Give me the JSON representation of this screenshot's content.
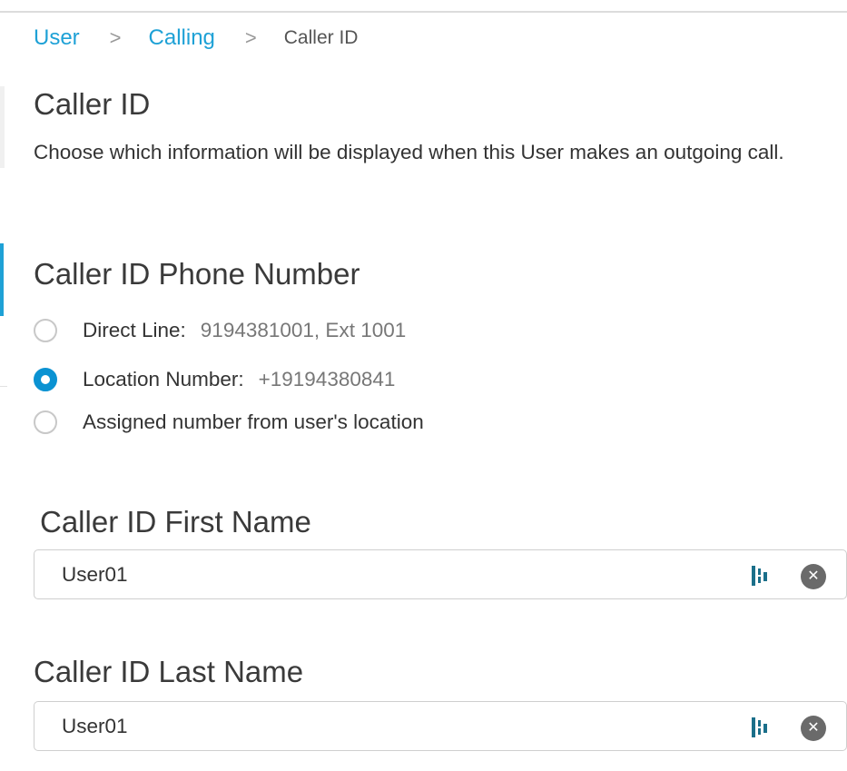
{
  "breadcrumb": {
    "items": [
      "User",
      "Calling"
    ],
    "separator": ">",
    "current": "Caller ID"
  },
  "page": {
    "title": "Caller ID",
    "description": "Choose which information will be displayed when this User makes an outgoing call."
  },
  "phone_number": {
    "title": "Caller ID Phone Number",
    "options": [
      {
        "label": "Direct Line:",
        "value": "9194381001, Ext 1001",
        "selected": false
      },
      {
        "label": "Location Number:",
        "value": "+19194380841",
        "selected": true
      },
      {
        "label": "Assigned number from user's location",
        "value": "",
        "selected": false
      }
    ]
  },
  "first_name": {
    "label": "Caller ID First Name",
    "value": "User01"
  },
  "last_name": {
    "label": "Caller ID Last Name",
    "value": "User01"
  },
  "icons": {
    "field_action": "password-manager-icon",
    "clear": "clear-circle-icon"
  },
  "colors": {
    "accent": "#1ea1d6",
    "radio_selected": "#0a92d2"
  }
}
